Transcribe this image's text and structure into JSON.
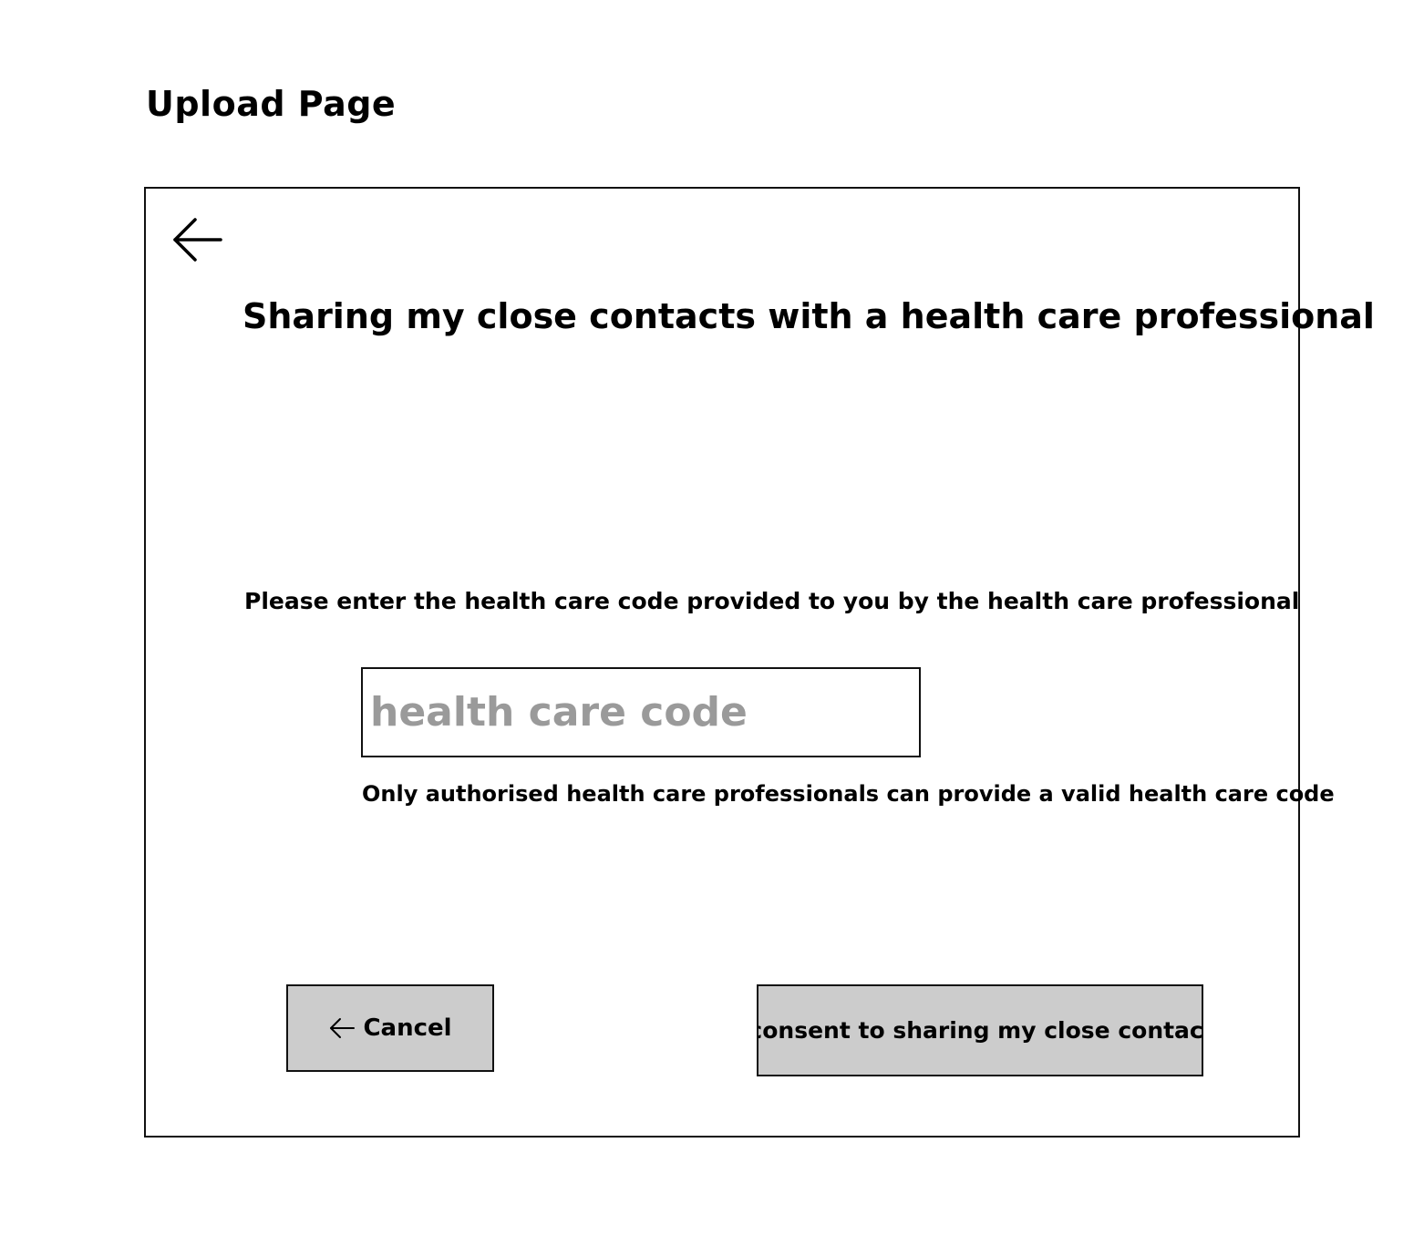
{
  "page": {
    "title": "Upload Page"
  },
  "screen": {
    "heading": "Sharing my close contacts with a health care professional",
    "instruction": "Please enter the health care code provided to you by the health care professional",
    "code_input": {
      "value": "",
      "placeholder": "health care code"
    },
    "helper_text": "Only authorised health care professionals can provide a valid health care code",
    "cancel_button": {
      "label": "Cancel",
      "icon": "arrow-left-icon"
    },
    "consent_button": {
      "label": "I consent to sharing my close contacts"
    },
    "back_icon": "arrow-left-icon"
  },
  "colors": {
    "button_fill": "#cccccc",
    "placeholder_text": "#9a9a9a",
    "border": "#111111"
  }
}
